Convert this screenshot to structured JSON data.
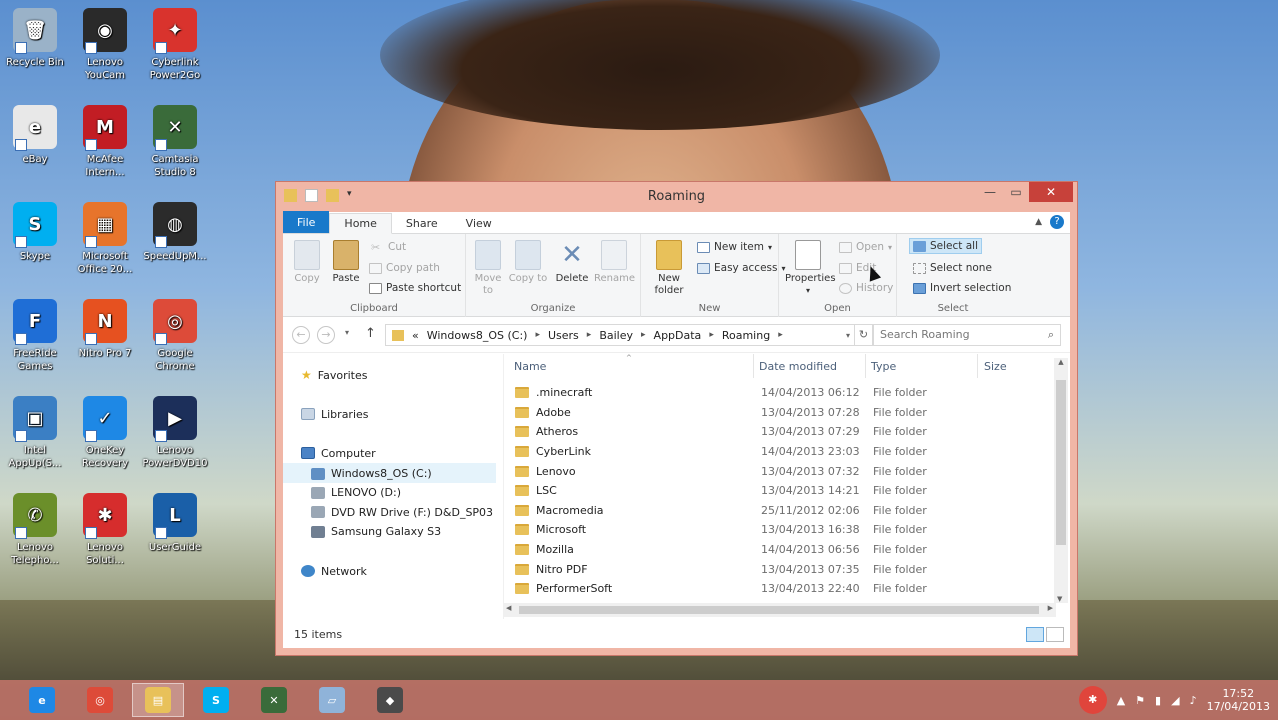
{
  "desktop": {
    "icons": [
      {
        "label": "Recycle Bin",
        "color": "#9ab2c8",
        "glyph": "🗑"
      },
      {
        "label": "Lenovo YouCam",
        "color": "#2a2a2a",
        "glyph": "◉"
      },
      {
        "label": "Cyberlink Power2Go",
        "color": "#d9332d",
        "glyph": "✦"
      },
      {
        "label": "eBay",
        "color": "#e8e8e8",
        "glyph": "e"
      },
      {
        "label": "McAfee Intern...",
        "color": "#c21d24",
        "glyph": "M"
      },
      {
        "label": "Camtasia Studio 8",
        "color": "#3a6b3a",
        "glyph": "✕"
      },
      {
        "label": "Skype",
        "color": "#00aff0",
        "glyph": "S"
      },
      {
        "label": "Microsoft Office 20...",
        "color": "#e7742b",
        "glyph": "▦"
      },
      {
        "label": "SpeedUpM...",
        "color": "#2b2b2b",
        "glyph": "◍"
      },
      {
        "label": "FreeRide Games",
        "color": "#1f6ed6",
        "glyph": "F"
      },
      {
        "label": "Nitro Pro 7",
        "color": "#e65120",
        "glyph": "N"
      },
      {
        "label": "Google Chrome",
        "color": "#dd4b39",
        "glyph": "◎"
      },
      {
        "label": "Intel AppUp(S...",
        "color": "#3b7fc4",
        "glyph": "▣"
      },
      {
        "label": "OneKey Recovery",
        "color": "#1e88e5",
        "glyph": "✓"
      },
      {
        "label": "Lenovo PowerDVD10",
        "color": "#1c2f5a",
        "glyph": "▶"
      },
      {
        "label": "Lenovo Telepho...",
        "color": "#6b8f2a",
        "glyph": "✆"
      },
      {
        "label": "Lenovo Soluti...",
        "color": "#d62d2d",
        "glyph": "✱"
      },
      {
        "label": "UserGuide",
        "color": "#1a5fa8",
        "glyph": "L"
      }
    ]
  },
  "window": {
    "title": "Roaming",
    "tabs": {
      "file": "File",
      "home": "Home",
      "share": "Share",
      "view": "View"
    },
    "ribbon": {
      "clipboard": {
        "label": "Clipboard",
        "copy": "Copy",
        "paste": "Paste",
        "cut": "Cut",
        "copy_path": "Copy path",
        "paste_shortcut": "Paste shortcut"
      },
      "organize": {
        "label": "Organize",
        "move_to": "Move to",
        "copy_to": "Copy to",
        "delete": "Delete",
        "rename": "Rename"
      },
      "new": {
        "label": "New",
        "new_folder": "New folder",
        "new_item": "New item",
        "easy_access": "Easy access"
      },
      "open": {
        "label": "Open",
        "properties": "Properties",
        "open": "Open",
        "edit": "Edit",
        "history": "History"
      },
      "select": {
        "label": "Select",
        "select_all": "Select all",
        "select_none": "Select none",
        "invert_selection": "Invert selection"
      }
    },
    "address": {
      "prefix": "«",
      "segments": [
        "Windows8_OS (C:)",
        "Users",
        "Bailey",
        "AppData",
        "Roaming"
      ],
      "search_placeholder": "Search Roaming"
    },
    "nav": {
      "favorites": "Favorites",
      "libraries": "Libraries",
      "computer": "Computer",
      "drives": [
        "Windows8_OS (C:)",
        "LENOVO (D:)",
        "DVD RW Drive (F:) D&D_SP03",
        "Samsung Galaxy S3"
      ],
      "network": "Network"
    },
    "columns": {
      "name": "Name",
      "date": "Date modified",
      "type": "Type",
      "size": "Size"
    },
    "files": [
      {
        "name": ".minecraft",
        "date": "14/04/2013 06:12",
        "type": "File folder"
      },
      {
        "name": "Adobe",
        "date": "13/04/2013 07:28",
        "type": "File folder"
      },
      {
        "name": "Atheros",
        "date": "13/04/2013 07:29",
        "type": "File folder"
      },
      {
        "name": "CyberLink",
        "date": "14/04/2013 23:03",
        "type": "File folder"
      },
      {
        "name": "Lenovo",
        "date": "13/04/2013 07:32",
        "type": "File folder"
      },
      {
        "name": "LSC",
        "date": "13/04/2013 14:21",
        "type": "File folder"
      },
      {
        "name": "Macromedia",
        "date": "25/11/2012 02:06",
        "type": "File folder"
      },
      {
        "name": "Microsoft",
        "date": "13/04/2013 16:38",
        "type": "File folder"
      },
      {
        "name": "Mozilla",
        "date": "14/04/2013 06:56",
        "type": "File folder"
      },
      {
        "name": "Nitro PDF",
        "date": "13/04/2013 07:35",
        "type": "File folder"
      },
      {
        "name": "PerformerSoft",
        "date": "13/04/2013 22:40",
        "type": "File folder"
      }
    ],
    "status": "15 items"
  },
  "taskbar": {
    "items": [
      {
        "name": "internet-explorer",
        "color": "#1e88e5",
        "glyph": "e"
      },
      {
        "name": "chrome",
        "color": "#dd4b39",
        "glyph": "◎"
      },
      {
        "name": "file-explorer",
        "color": "#e8c15a",
        "glyph": "▤"
      },
      {
        "name": "skype",
        "color": "#00aff0",
        "glyph": "S"
      },
      {
        "name": "camtasia",
        "color": "#3a6b3a",
        "glyph": "✕"
      },
      {
        "name": "notepad",
        "color": "#8fb3d9",
        "glyph": "▱"
      },
      {
        "name": "camtasia-recorder",
        "color": "#4a4a4a",
        "glyph": "◆"
      }
    ],
    "time": "17:52",
    "date": "17/04/2013"
  }
}
